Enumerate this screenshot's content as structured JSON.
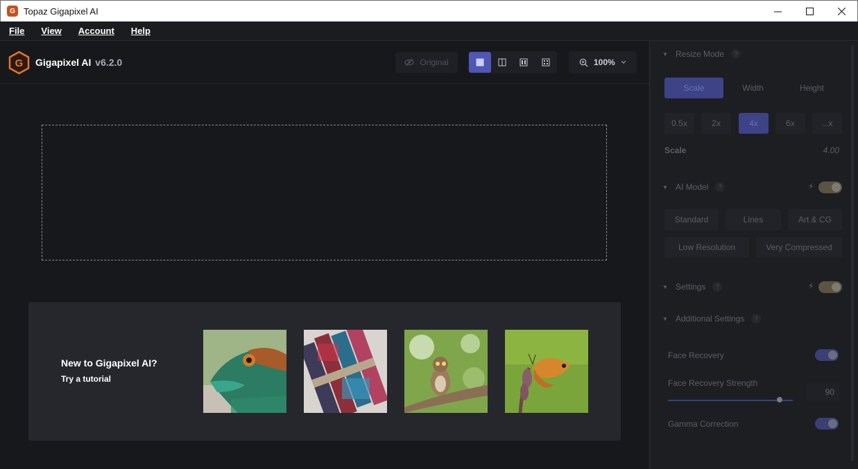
{
  "window": {
    "title": "Topaz Gigapixel AI"
  },
  "menu": [
    "File",
    "View",
    "Account",
    "Help"
  ],
  "brand": {
    "name": "Gigapixel AI",
    "version": "v6.2.0",
    "accent": "#e8742c"
  },
  "toolbar": {
    "original_label": "Original",
    "zoom_label": "100%"
  },
  "tutorial": {
    "title": "New to Gigapixel AI?",
    "subtitle": "Try a tutorial",
    "thumbnails": [
      "lizard",
      "paint-brushes",
      "owl",
      "butterfly"
    ]
  },
  "panel": {
    "resize_mode": {
      "title": "Resize Mode",
      "tabs": [
        "Scale",
        "Width",
        "Height"
      ],
      "active_tab": "Scale",
      "scales": [
        "0.5x",
        "2x",
        "4x",
        "6x",
        "...x"
      ],
      "active_scale": "4x",
      "scale_label": "Scale",
      "scale_value": "4.00"
    },
    "ai_model": {
      "title": "AI Model",
      "row1": [
        "Standard",
        "Lines",
        "Art & CG"
      ],
      "row2": [
        "Low Resolution",
        "Very Compressed"
      ]
    },
    "settings": {
      "title": "Settings"
    },
    "additional": {
      "title": "Additional Settings",
      "face_recovery": "Face Recovery",
      "face_recovery_strength": "Face Recovery Strength",
      "strength_value": "90",
      "gamma_correction": "Gamma Correction"
    }
  },
  "colors": {
    "active_blue": "#4f56b4",
    "toggle_on": "#3b3f75",
    "toggle_warm": "#5b5442"
  }
}
